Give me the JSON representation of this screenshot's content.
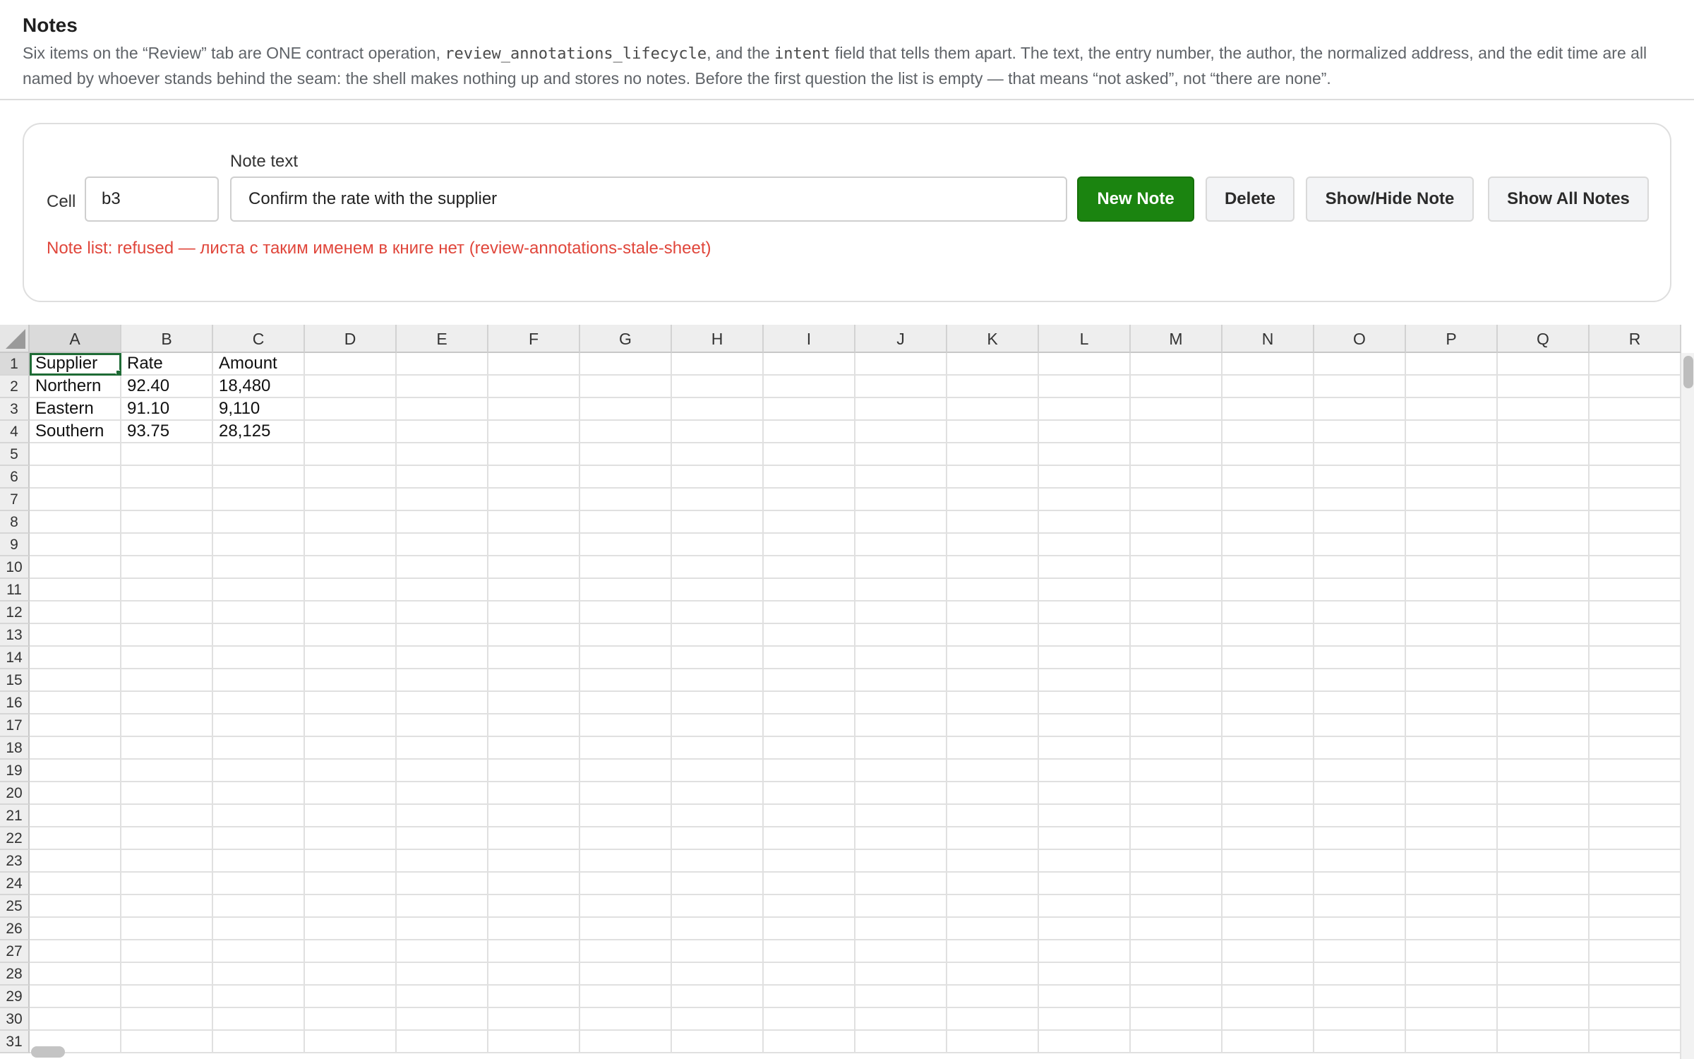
{
  "header": {
    "title": "Notes",
    "desc_part1": "Six items on the “Review” tab are ONE contract operation, ",
    "desc_code1": "review_annotations_lifecycle",
    "desc_part2": ", and the ",
    "desc_code2": "intent",
    "desc_part3": " field that tells them apart. The text, the entry number, the author, the normalized address, and the edit time are all named by whoever stands behind the seam: the shell makes nothing up and stores no notes. Before the first question the list is empty — that means “not asked”, not “there are none”."
  },
  "panel": {
    "cell_label": "Cell",
    "cell_value": "b3",
    "note_label": "Note text",
    "note_value": "Confirm the rate with the supplier",
    "buttons": {
      "new_note": "New Note",
      "delete": "Delete",
      "show_hide": "Show/Hide Note",
      "show_all": "Show All Notes"
    },
    "status": "Note list: refused — листа с таким именем в книге нет (review-annotations-stale-sheet)"
  },
  "colors": {
    "accent_green": "#1b8410",
    "error_red": "#e0463b",
    "selection_green": "#1e6b35"
  },
  "sheet": {
    "columns": [
      "A",
      "B",
      "C",
      "D",
      "E",
      "F",
      "G",
      "H",
      "I",
      "J",
      "K",
      "L",
      "M",
      "N",
      "O",
      "P",
      "Q",
      "R"
    ],
    "row_count": 31,
    "active_column": "A",
    "active_row": 1,
    "selected_cell": "A1",
    "rows": [
      [
        "Supplier",
        "Rate",
        "Amount"
      ],
      [
        "Northern",
        "92.40",
        "18,480"
      ],
      [
        "Eastern",
        "91.10",
        "9,110"
      ],
      [
        "Southern",
        "93.75",
        "28,125"
      ]
    ]
  }
}
